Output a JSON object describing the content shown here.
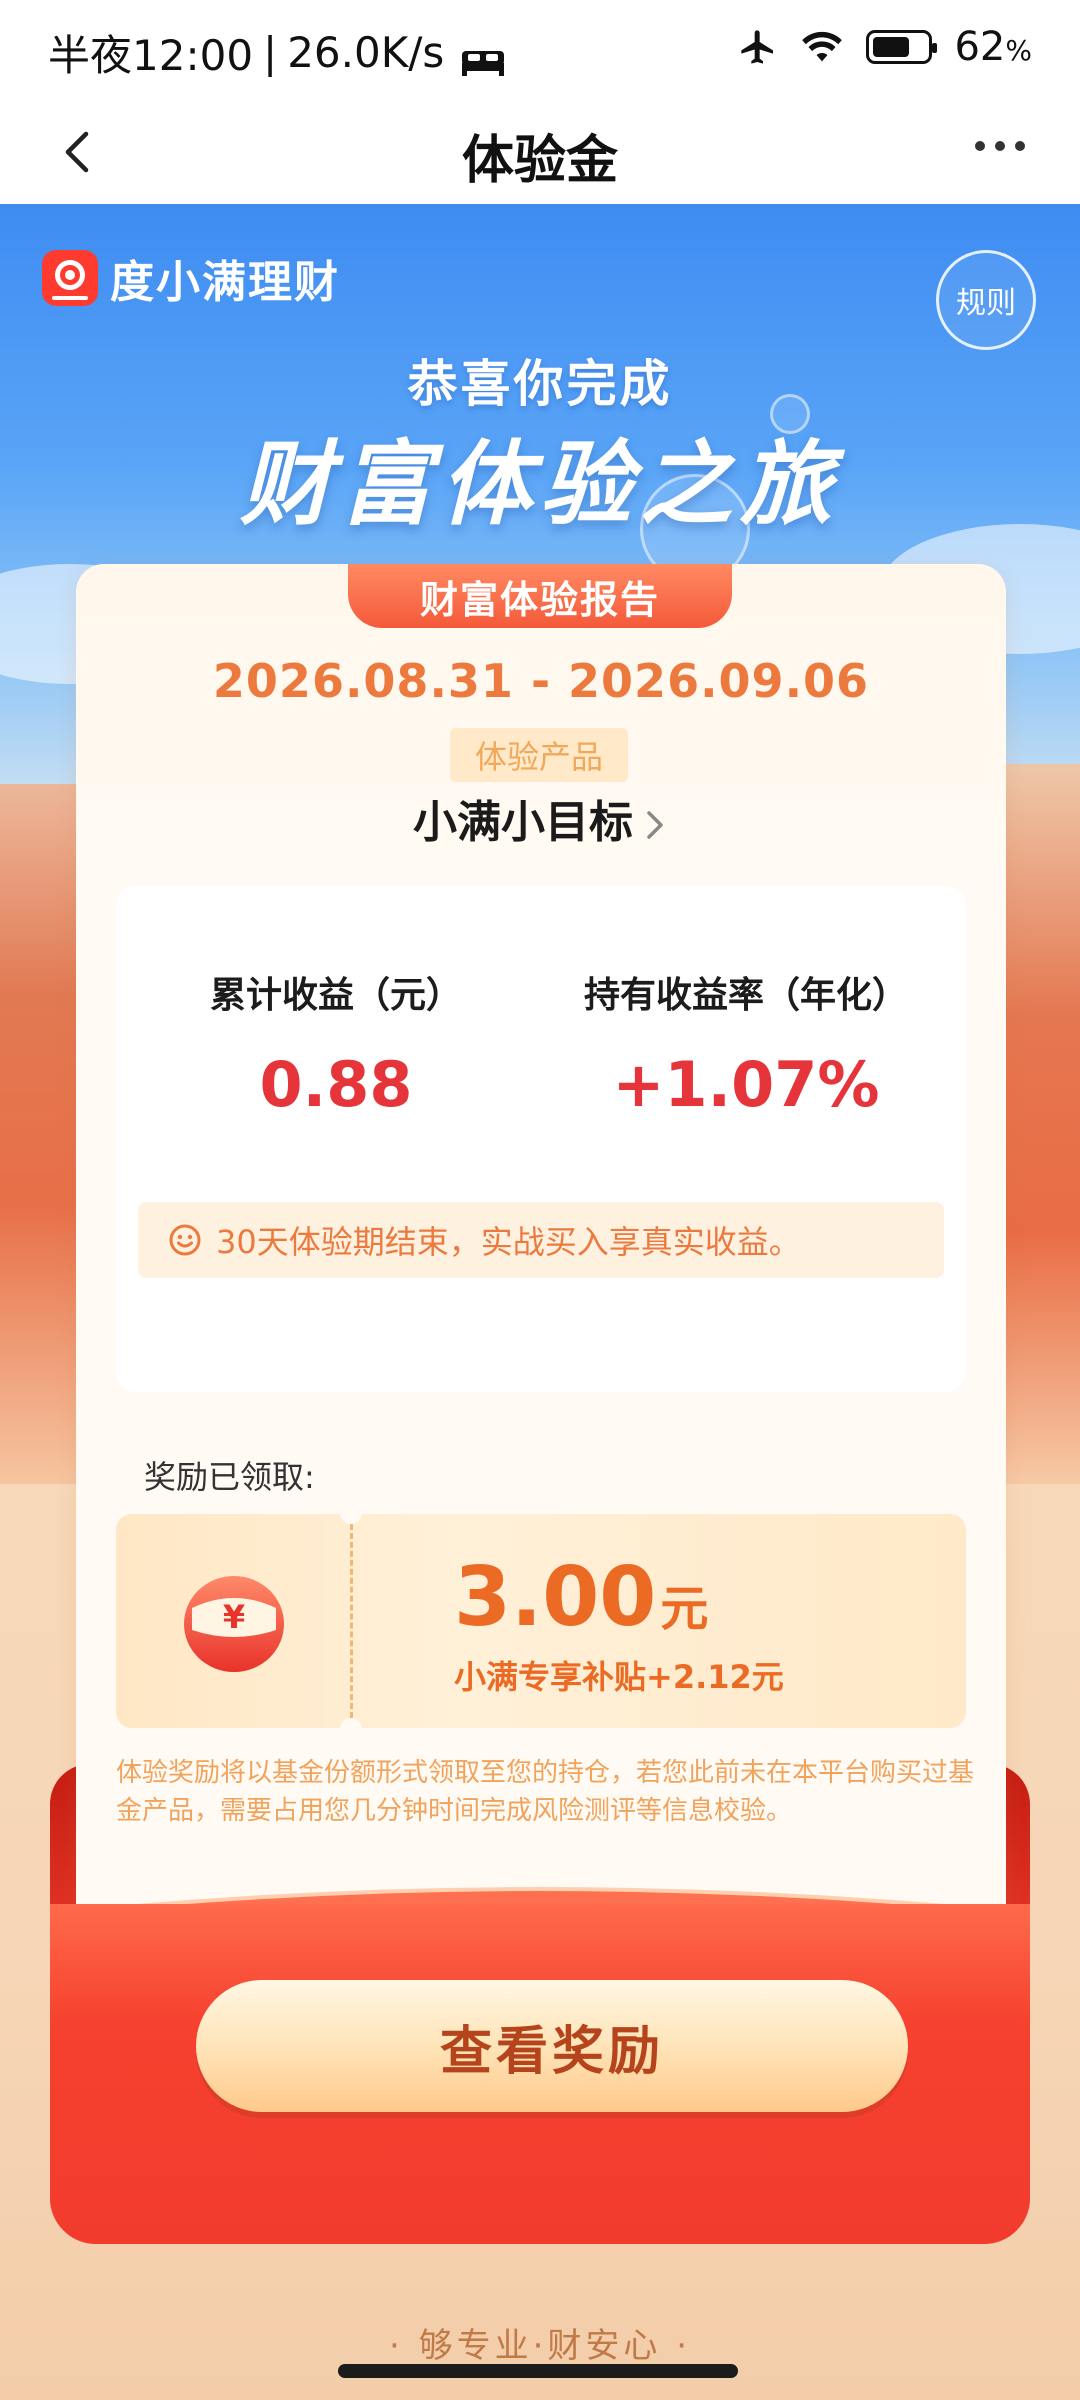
{
  "status_bar": {
    "time": "半夜12:00",
    "speed": "26.0K/s",
    "battery": "62",
    "battery_unit": "%"
  },
  "nav": {
    "title": "体验金"
  },
  "brand": {
    "name": "度小满理财"
  },
  "rules_label": "规则",
  "hero": {
    "congrats": "恭喜你完成",
    "headline": "财富体验之旅"
  },
  "report": {
    "tab_title": "财富体验报告",
    "date_range": "2026.08.31 - 2026.09.06",
    "product_badge": "体验产品",
    "product_name": "小满小目标"
  },
  "stats": {
    "cumulative_label": "累计收益（元）",
    "cumulative_value": "0.88",
    "rate_label": "持有收益率（年化）",
    "rate_value": "+1.07%",
    "tip": "30天体验期结束，实战买入享真实收益。"
  },
  "reward": {
    "label": "奖励已领取:",
    "currency_symbol": "¥",
    "amount": "3.00",
    "unit": "元",
    "subsidy": "小满专享补贴+2.12元"
  },
  "disclaimer": "体验奖励将以基金份额形式领取至您的持仓，若您此前未在本平台购买过基金产品，需要占用您几分钟时间完成风险测评等信息校验。",
  "cta": {
    "label": "查看奖励"
  },
  "slogan": "· 够专业·财安心 ·",
  "colors": {
    "accent_orange": "#ec7a3e",
    "value_red": "#e6353a",
    "envelope_red": "#f23b2d",
    "sky_blue": "#3e8cf2"
  }
}
